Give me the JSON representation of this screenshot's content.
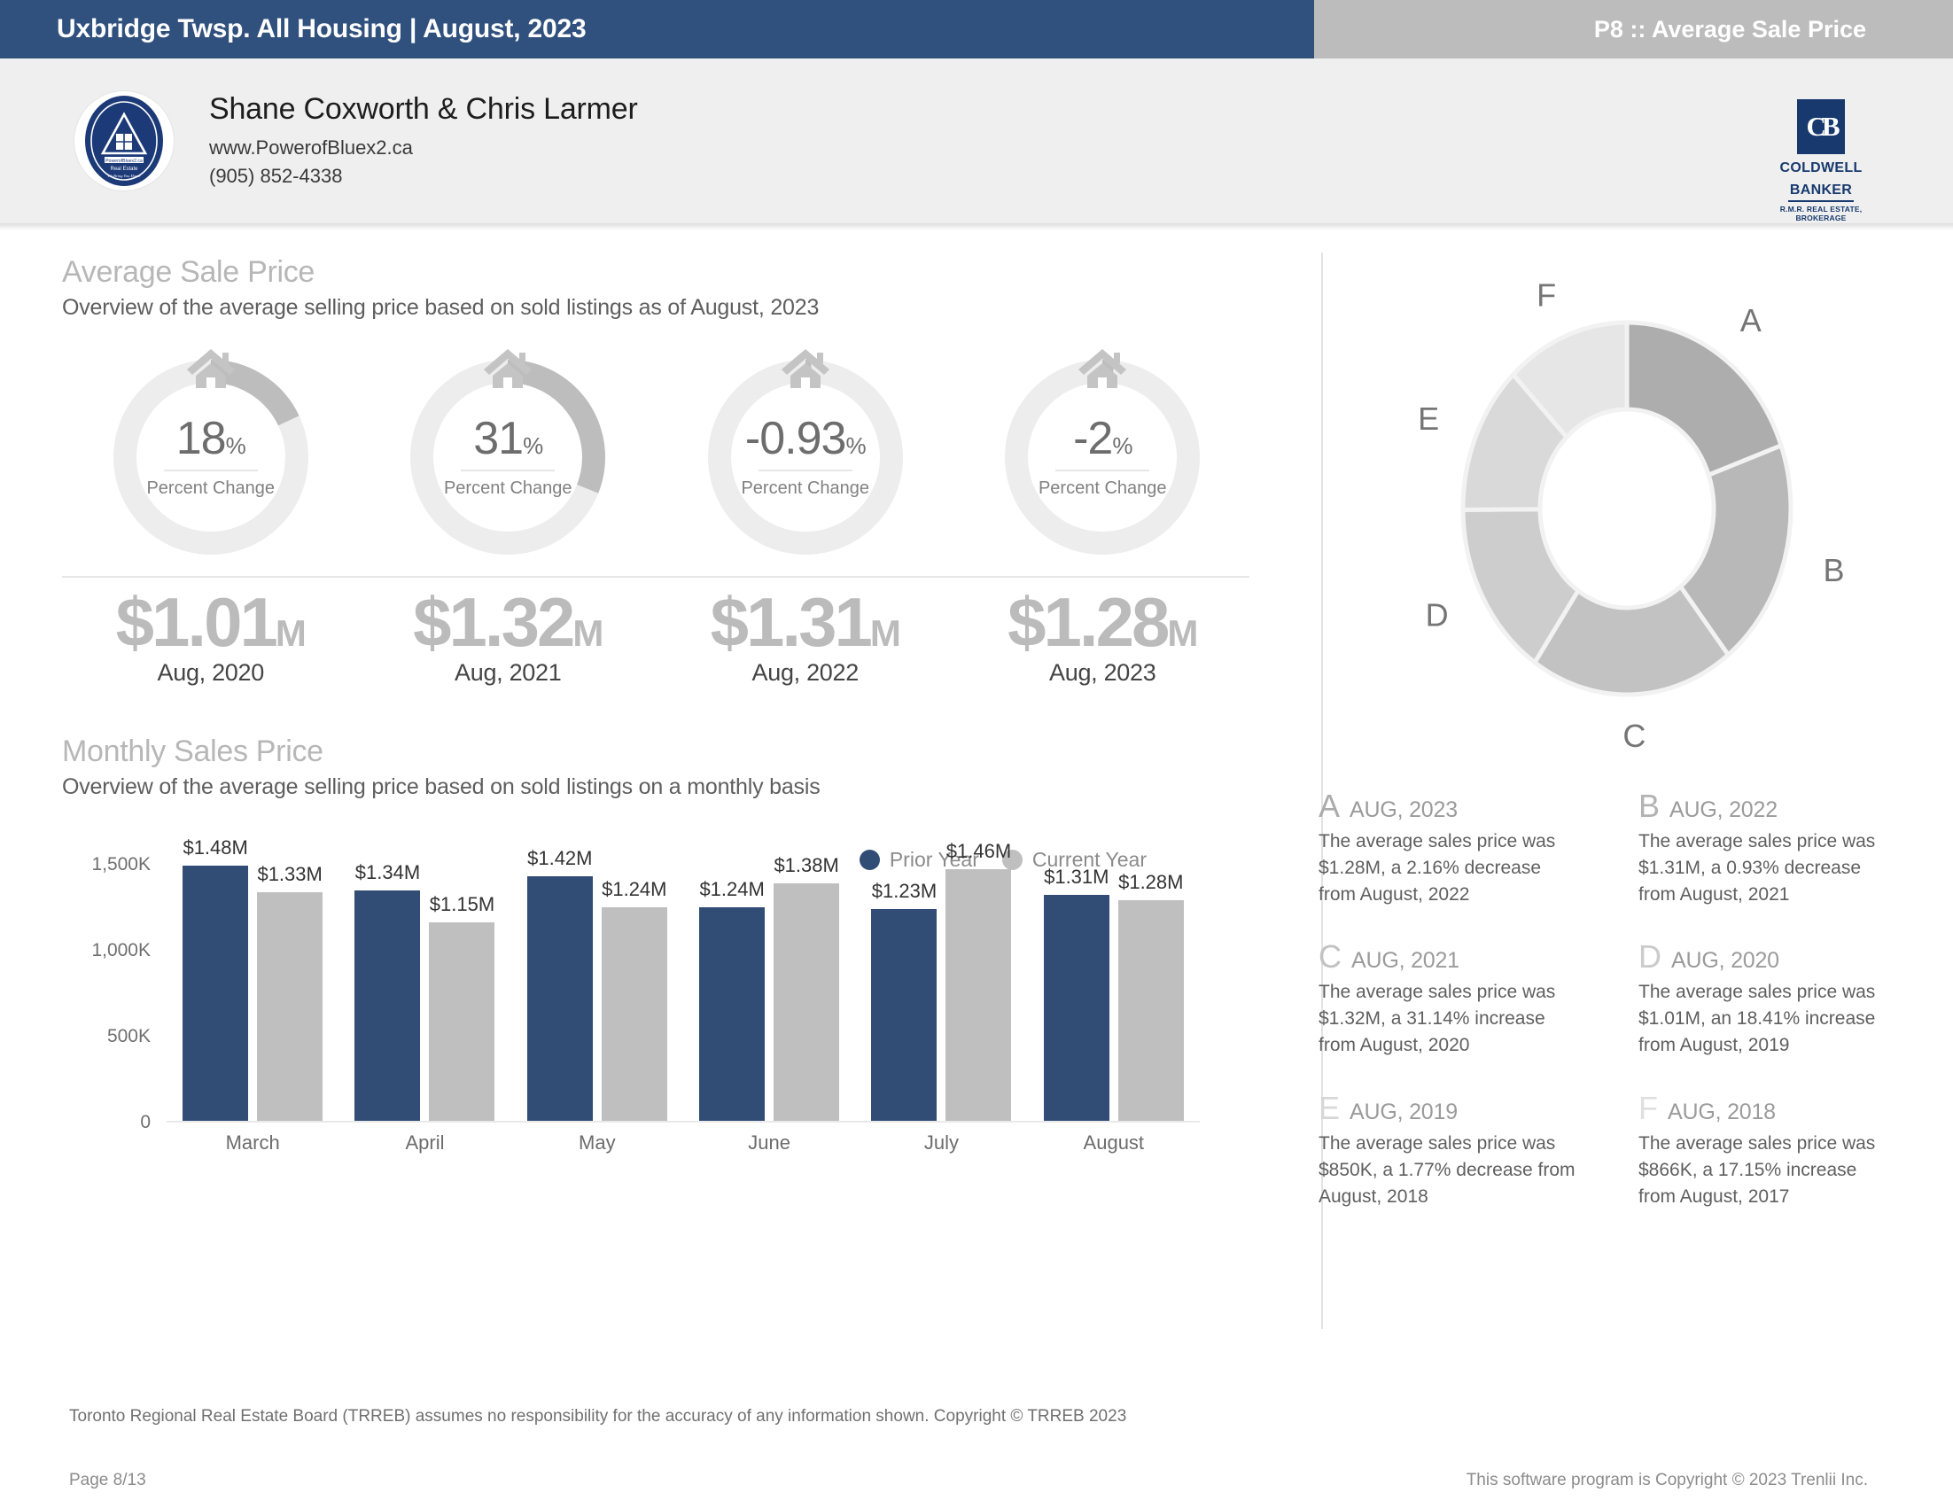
{
  "header": {
    "title": "Uxbridge Twsp. All Housing | August, 2023",
    "page_label": "P8 :: Average Sale Price",
    "brand_colors": {
      "navy": "#30507E",
      "gray": "#BCBCBC",
      "bar_navy": "#314D75",
      "bar_gray": "#BFBFBF"
    }
  },
  "agent": {
    "name": "Shane Coxworth & Chris Larmer",
    "website": "www.PowerofBluex2.ca",
    "phone": "(905) 852-4338",
    "seal_text": "PowerofBluex2.ca",
    "brokerage": {
      "monogram": "CB",
      "line1": "COLDWELL",
      "line2": "BANKER",
      "sub1": "R.M.R. REAL ESTATE,",
      "sub2": "BROKERAGE"
    }
  },
  "avg_sale_price": {
    "title": "Average Sale Price",
    "subtitle": "Overview of the average selling price based on sold listings as of August, 2023",
    "gauges": [
      {
        "value": "18",
        "unit": "%",
        "label": "Percent Change",
        "arc_pct": 18
      },
      {
        "value": "31",
        "unit": "%",
        "label": "Percent Change",
        "arc_pct": 31
      },
      {
        "value": "-0.93",
        "unit": "%",
        "label": "Percent Change",
        "arc_pct": 1
      },
      {
        "value": "-2",
        "unit": "%",
        "label": "Percent Change",
        "arc_pct": 2
      }
    ],
    "prices": [
      {
        "value": "$1.01",
        "suffix": "M",
        "label": "Aug, 2020"
      },
      {
        "value": "$1.32",
        "suffix": "M",
        "label": "Aug, 2021"
      },
      {
        "value": "$1.31",
        "suffix": "M",
        "label": "Aug, 2022"
      },
      {
        "value": "$1.28",
        "suffix": "M",
        "label": "Aug, 2023"
      }
    ]
  },
  "monthly_sales": {
    "title": "Monthly Sales Price",
    "subtitle": "Overview of the average selling price based on sold listings on a monthly basis",
    "legend": [
      {
        "label": "Prior Year",
        "color": "#314D75"
      },
      {
        "label": "Current Year",
        "color": "#BFBFBF"
      }
    ]
  },
  "chart_data": {
    "type": "bar",
    "title": "Monthly Sales Price",
    "categories": [
      "March",
      "April",
      "May",
      "June",
      "July",
      "August"
    ],
    "series": [
      {
        "name": "Prior Year",
        "color": "#314D75",
        "values": [
          1480000,
          1340000,
          1420000,
          1240000,
          1230000,
          1310000
        ],
        "labels": [
          "$1.48M",
          "$1.34M",
          "$1.42M",
          "$1.24M",
          "$1.23M",
          "$1.31M"
        ]
      },
      {
        "name": "Current Year",
        "color": "#BFBFBF",
        "values": [
          1330000,
          1150000,
          1240000,
          1380000,
          1460000,
          1280000
        ],
        "labels": [
          "$1.33M",
          "$1.15M",
          "$1.24M",
          "$1.38M",
          "$1.46M",
          "$1.28M"
        ]
      }
    ],
    "xlabel": "",
    "ylabel": "",
    "ylim": [
      0,
      1700000
    ],
    "yticks": [
      0,
      500000,
      1000000,
      1500000
    ],
    "ytick_labels": [
      "0",
      "500K",
      "1,000K",
      "1,500K"
    ],
    "grid": false,
    "legend_position": "top-right"
  },
  "donut": {
    "type": "pie",
    "labels": [
      "A",
      "B",
      "C",
      "D",
      "E",
      "F"
    ],
    "values": [
      1.28,
      1.31,
      1.32,
      1.01,
      0.85,
      0.866
    ],
    "colors": [
      "#ADADAD",
      "#B8B8B8",
      "#C2C2C2",
      "#CDCDCD",
      "#D9D9D9",
      "#E6E6E6"
    ],
    "segments": [
      {
        "letter": "A",
        "pct": 19.5,
        "color": "#ADADAD"
      },
      {
        "letter": "B",
        "pct": 19.9,
        "color": "#B8B8B8"
      },
      {
        "letter": "C",
        "pct": 20.1,
        "color": "#C2C2C2"
      },
      {
        "letter": "D",
        "pct": 15.4,
        "color": "#CDCDCD"
      },
      {
        "letter": "E",
        "pct": 12.9,
        "color": "#D9D9D9"
      },
      {
        "letter": "F",
        "pct": 12.2,
        "color": "#E6E6E6"
      }
    ]
  },
  "donut_legend": [
    {
      "letter": "A",
      "letter_color": "#ABABAB",
      "date": "AUG, 2023",
      "body": "The average sales price was $1.28M, a 2.16% decrease from August, 2022"
    },
    {
      "letter": "B",
      "letter_color": "#B3B3B3",
      "date": "AUG, 2022",
      "body": "The average sales price was $1.31M, a 0.93% decrease from August, 2021"
    },
    {
      "letter": "C",
      "letter_color": "#C2C2C2",
      "date": "AUG, 2021",
      "body": "The average sales price was $1.32M, a 31.14% increase from August, 2020"
    },
    {
      "letter": "D",
      "letter_color": "#CBCBCB",
      "date": "AUG, 2020",
      "body": "The average sales price was $1.01M, an 18.41% increase from August, 2019"
    },
    {
      "letter": "E",
      "letter_color": "#D7D7D7",
      "date": "AUG, 2019",
      "body": "The average sales price was $850K, a 1.77% decrease from August, 2018"
    },
    {
      "letter": "F",
      "letter_color": "#E0E0E0",
      "date": "AUG, 2018",
      "body": "The average sales price was $866K, a 17.15% increase from August, 2017"
    }
  ],
  "footer": {
    "disclaimer": "Toronto Regional Real Estate Board (TRREB) assumes no responsibility for the accuracy of any information shown. Copyright © TRREB 2023",
    "page": "Page 8/13",
    "copyright": "This software program is Copyright © 2023 Trenlii Inc."
  }
}
